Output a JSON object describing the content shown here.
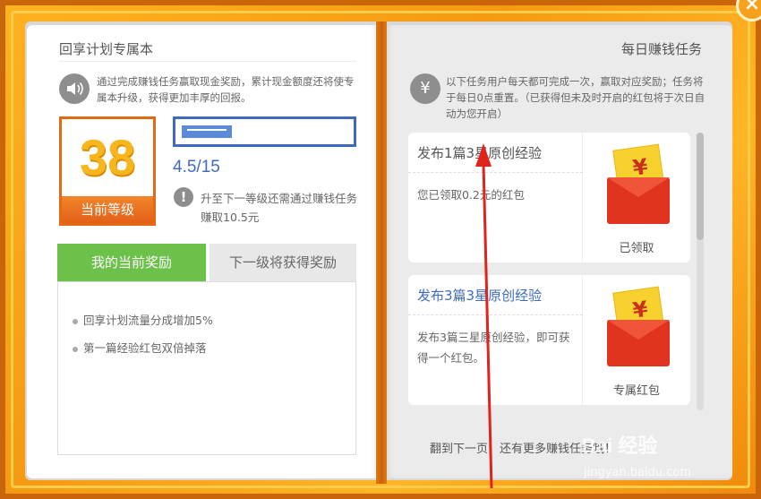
{
  "left": {
    "title": "回享计划专属本",
    "intro": "通过完成赚钱任务赢取现金奖励，累计现金额度还将使专属本升级，获得更加丰厚的回报。",
    "level": {
      "value": "38",
      "label": "当前等级"
    },
    "progress": {
      "value_text": "4.5/15",
      "fraction": 0.3
    },
    "upgrade_hint": "升至下一等级还需通过赚钱任务赚取10.5元",
    "tabs": [
      {
        "label": "我的当前奖励",
        "active": true
      },
      {
        "label": "下一级将获得奖励",
        "active": false
      }
    ],
    "rewards": [
      "回享计划流量分成增加5%",
      "第一篇经验红包双倍掉落"
    ]
  },
  "right": {
    "title": "每日赚钱任务",
    "intro": "以下任务用户每天都可完成一次，赢取对应奖励；任务将于每日0点重置。（已获得但未及时开启的红包将于次日自动为您开启）",
    "tasks": [
      {
        "title": "发布1篇3星原创经验",
        "desc": "您已领取0.2元的红包",
        "status": "已领取",
        "title_color": "#555555"
      },
      {
        "title": "发布3篇3星原创经验",
        "desc": "发布3篇三星原创经验，即可获得一个红包。",
        "status": "专属红包",
        "title_color": "#3e6bbf"
      }
    ],
    "footer": "翻到下一页，还有更多赚钱任务哦！"
  },
  "icons": {
    "close": "close-icon",
    "speaker": "speaker-icon",
    "yen": "yen-icon",
    "alert": "alert-icon",
    "envelope": "red-envelope-icon"
  },
  "watermark": {
    "brand": "Bai 经验",
    "url": "jingyan.baidu.com"
  },
  "colors": {
    "accent_orange": "#e26a14",
    "progress_blue": "#3e6bbf",
    "tab_green": "#6cc14a",
    "envelope_red": "#e0341e"
  }
}
